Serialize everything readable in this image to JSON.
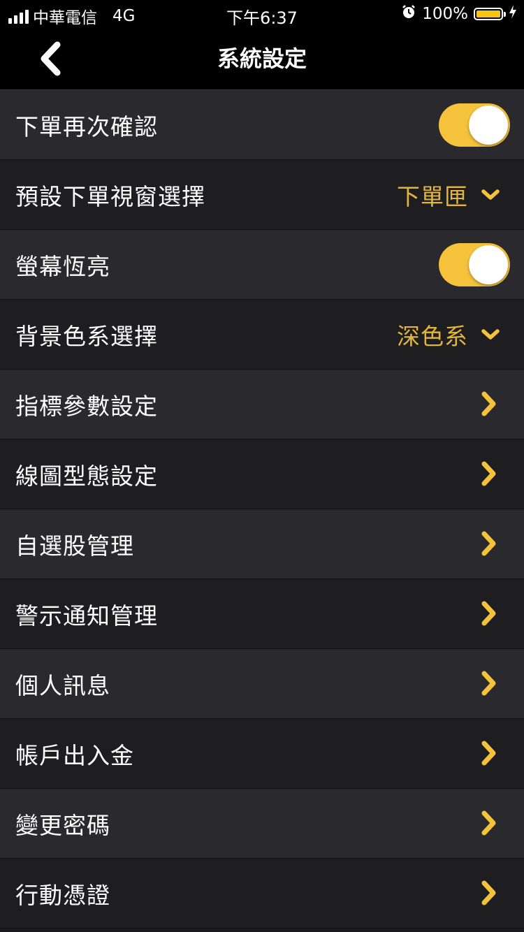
{
  "status_bar": {
    "carrier": "中華電信",
    "network": "4G",
    "time": "下午6:37",
    "battery": "100%",
    "battery_level": 1.0
  },
  "nav": {
    "title": "系統設定",
    "back_icon": "chevron-left-icon"
  },
  "colors": {
    "accent": "#f5c33b",
    "value_text": "#e3b53a",
    "row_light": "#2a2a2e",
    "row_dark": "#1e1e21",
    "nav_bg": "#000000"
  },
  "settings": {
    "order_confirm": {
      "label": "下單再次確認",
      "enabled": true
    },
    "order_window": {
      "label": "預設下單視窗選擇",
      "value": "下單匣"
    },
    "screen_on": {
      "label": "螢幕恆亮",
      "enabled": true
    },
    "background_theme": {
      "label": "背景色系選擇",
      "value": "深色系"
    },
    "indicator_params": {
      "label": "指標參數設定"
    },
    "chart_style": {
      "label": "線圖型態設定"
    },
    "watchlist": {
      "label": "自選股管理"
    },
    "alert_notify": {
      "label": "警示通知管理"
    },
    "personal_info": {
      "label": "個人訊息"
    },
    "deposit_withdraw": {
      "label": "帳戶出入金"
    },
    "change_password": {
      "label": "變更密碼"
    },
    "mobile_cert": {
      "label": "行動憑證"
    }
  }
}
